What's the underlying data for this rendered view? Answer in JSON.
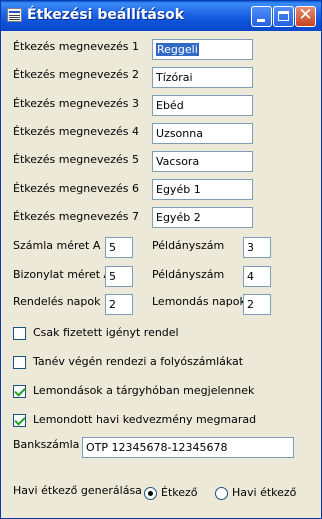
{
  "window": {
    "title": "Étkezési beállítások"
  },
  "meals": [
    {
      "label": "Étkezés megnevezés 1",
      "value": "Reggeli"
    },
    {
      "label": "Étkezés megnevezés 2",
      "value": "Tízórai"
    },
    {
      "label": "Étkezés megnevezés 3",
      "value": "Ebéd"
    },
    {
      "label": "Étkezés megnevezés 4",
      "value": "Uzsonna"
    },
    {
      "label": "Étkezés megnevezés 5",
      "value": "Vacsora"
    },
    {
      "label": "Étkezés megnevezés 6",
      "value": "Egyéb 1"
    },
    {
      "label": "Étkezés megnevezés 7",
      "value": "Egyéb 2"
    }
  ],
  "settings": {
    "invoice_size": {
      "label": "Számla méret A",
      "value": "5"
    },
    "invoice_copies": {
      "label": "Példányszám",
      "value": "3"
    },
    "receipt_size": {
      "label": "Bizonylat méret A",
      "value": "5"
    },
    "receipt_copies": {
      "label": "Példányszám",
      "value": "4"
    },
    "order_days": {
      "label": "Rendelés napok",
      "value": "2"
    },
    "cancel_days": {
      "label": "Lemondás napok",
      "value": "2"
    }
  },
  "checkboxes": [
    {
      "label": "Csak fizetett igényt rendel",
      "checked": false
    },
    {
      "label": "Tanév végén rendezi a folyószámlákat",
      "checked": false
    },
    {
      "label": "Lemondások a tárgyhóban megjelennek",
      "checked": true
    },
    {
      "label": "Lemondott havi kedvezmény megmarad",
      "checked": true
    }
  ],
  "bank": {
    "label": "Bankszámla",
    "value": "OTP 12345678-12345678"
  },
  "generation": {
    "label": "Havi étkező generálása",
    "options": [
      {
        "label": "Étkező",
        "selected": true
      },
      {
        "label": "Havi étkező",
        "selected": false
      }
    ]
  }
}
